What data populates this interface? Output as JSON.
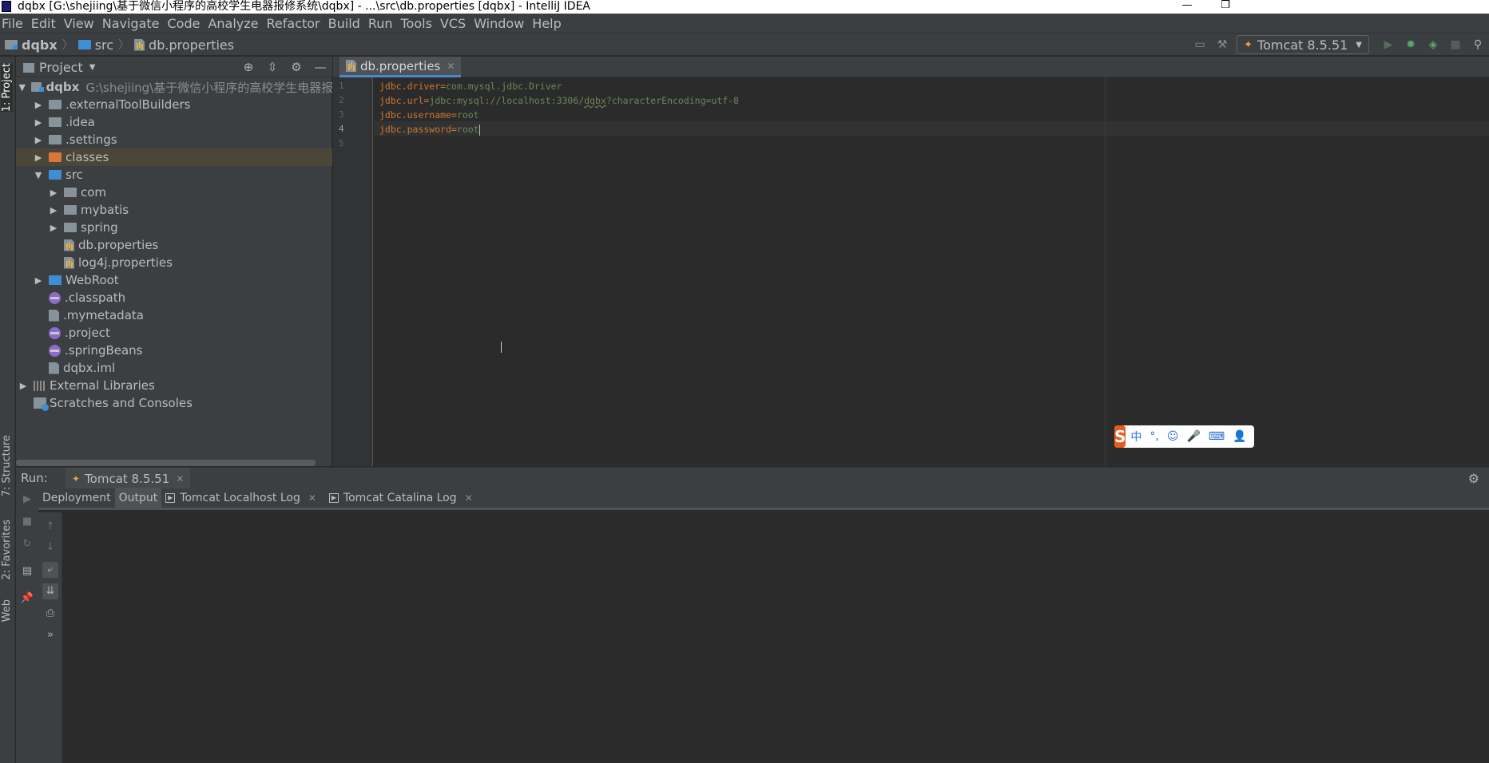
{
  "window": {
    "title": "dqbx [G:\\shejiing\\基于微信小程序的高校学生电器报修系统\\dqbx] - ...\\src\\db.properties [dqbx] - IntelliJ IDEA",
    "minimize": "—",
    "restore": "❐"
  },
  "menu": [
    "File",
    "Edit",
    "View",
    "Navigate",
    "Code",
    "Analyze",
    "Refactor",
    "Build",
    "Run",
    "Tools",
    "VCS",
    "Window",
    "Help"
  ],
  "breadcrumbs": [
    "dqbx",
    "src",
    "db.properties"
  ],
  "run_config": {
    "label": "Tomcat 8.5.51"
  },
  "left_stripe": {
    "project": "1: Project",
    "structure": "7: Structure",
    "favorites": "2: Favorites",
    "web": "Web"
  },
  "project_panel": {
    "title": "Project",
    "tree": [
      {
        "label": "dqbx",
        "path": "G:\\shejiing\\基于微信小程序的高校学生电器报修系统\\dq",
        "depth": 0,
        "arrow": "open",
        "icon": "module-folder-icon"
      },
      {
        "label": ".externalToolBuilders",
        "depth": 1,
        "arrow": "closed",
        "icon": "folder-icon"
      },
      {
        "label": ".idea",
        "depth": 1,
        "arrow": "closed",
        "icon": "folder-icon"
      },
      {
        "label": ".settings",
        "depth": 1,
        "arrow": "closed",
        "icon": "folder-icon"
      },
      {
        "label": "classes",
        "depth": 1,
        "arrow": "closed",
        "icon": "excluded-folder-icon",
        "selected": true
      },
      {
        "label": "src",
        "depth": 1,
        "arrow": "open",
        "icon": "source-folder-icon"
      },
      {
        "label": "com",
        "depth": 2,
        "arrow": "closed",
        "icon": "package-icon"
      },
      {
        "label": "mybatis",
        "depth": 2,
        "arrow": "closed",
        "icon": "package-icon"
      },
      {
        "label": "spring",
        "depth": 2,
        "arrow": "closed",
        "icon": "package-icon"
      },
      {
        "label": "db.properties",
        "depth": 2,
        "arrow": "none",
        "icon": "properties-file-icon"
      },
      {
        "label": "log4j.properties",
        "depth": 2,
        "arrow": "none",
        "icon": "properties-file-icon"
      },
      {
        "label": "WebRoot",
        "depth": 1,
        "arrow": "closed",
        "icon": "web-folder-icon"
      },
      {
        "label": ".classpath",
        "depth": 1,
        "arrow": "none",
        "icon": "eclipse-file-icon"
      },
      {
        "label": ".mymetadata",
        "depth": 1,
        "arrow": "none",
        "icon": "text-file-icon"
      },
      {
        "label": ".project",
        "depth": 1,
        "arrow": "none",
        "icon": "eclipse-file-icon"
      },
      {
        "label": ".springBeans",
        "depth": 1,
        "arrow": "none",
        "icon": "eclipse-file-icon"
      },
      {
        "label": "dqbx.iml",
        "depth": 1,
        "arrow": "none",
        "icon": "iml-file-icon"
      },
      {
        "label": "External Libraries",
        "depth": 0,
        "arrow": "closed",
        "icon": "library-icon"
      },
      {
        "label": "Scratches and Consoles",
        "depth": 0,
        "arrow": "none",
        "icon": "scratches-icon"
      }
    ]
  },
  "editor": {
    "tab": "db.properties",
    "lines": [
      {
        "n": "1",
        "key": "jdbc.driver",
        "eq": "=",
        "val": "com.mysql.jdbc.Driver"
      },
      {
        "n": "2",
        "key": "jdbc.url",
        "eq": "=",
        "val_a": "jdbc:mysql://localhost:3306/",
        "val_typo": "dqbx",
        "val_b": "?characterEncoding=utf-8"
      },
      {
        "n": "3",
        "key": "jdbc.username",
        "eq": "=",
        "val": "root"
      },
      {
        "n": "4",
        "key": "jdbc.password",
        "eq": "=",
        "val": "root"
      },
      {
        "n": "5",
        "key": "",
        "eq": "",
        "val": ""
      }
    ]
  },
  "ime": {
    "mode": "中",
    "punct": "°,",
    "smile": "☺",
    "mic": "🎤",
    "kbd": "⌨",
    "user": "👤",
    "logo": "S"
  },
  "run_panel": {
    "label": "Run:",
    "tab": "Tomcat 8.5.51",
    "subtabs": [
      "Deployment",
      "Output",
      "Tomcat Localhost Log",
      "Tomcat Catalina Log"
    ]
  },
  "colors": {
    "accent": "#4a88c7",
    "key": "#cc7832",
    "value": "#6a8759",
    "selected_row": "#4b4638"
  }
}
